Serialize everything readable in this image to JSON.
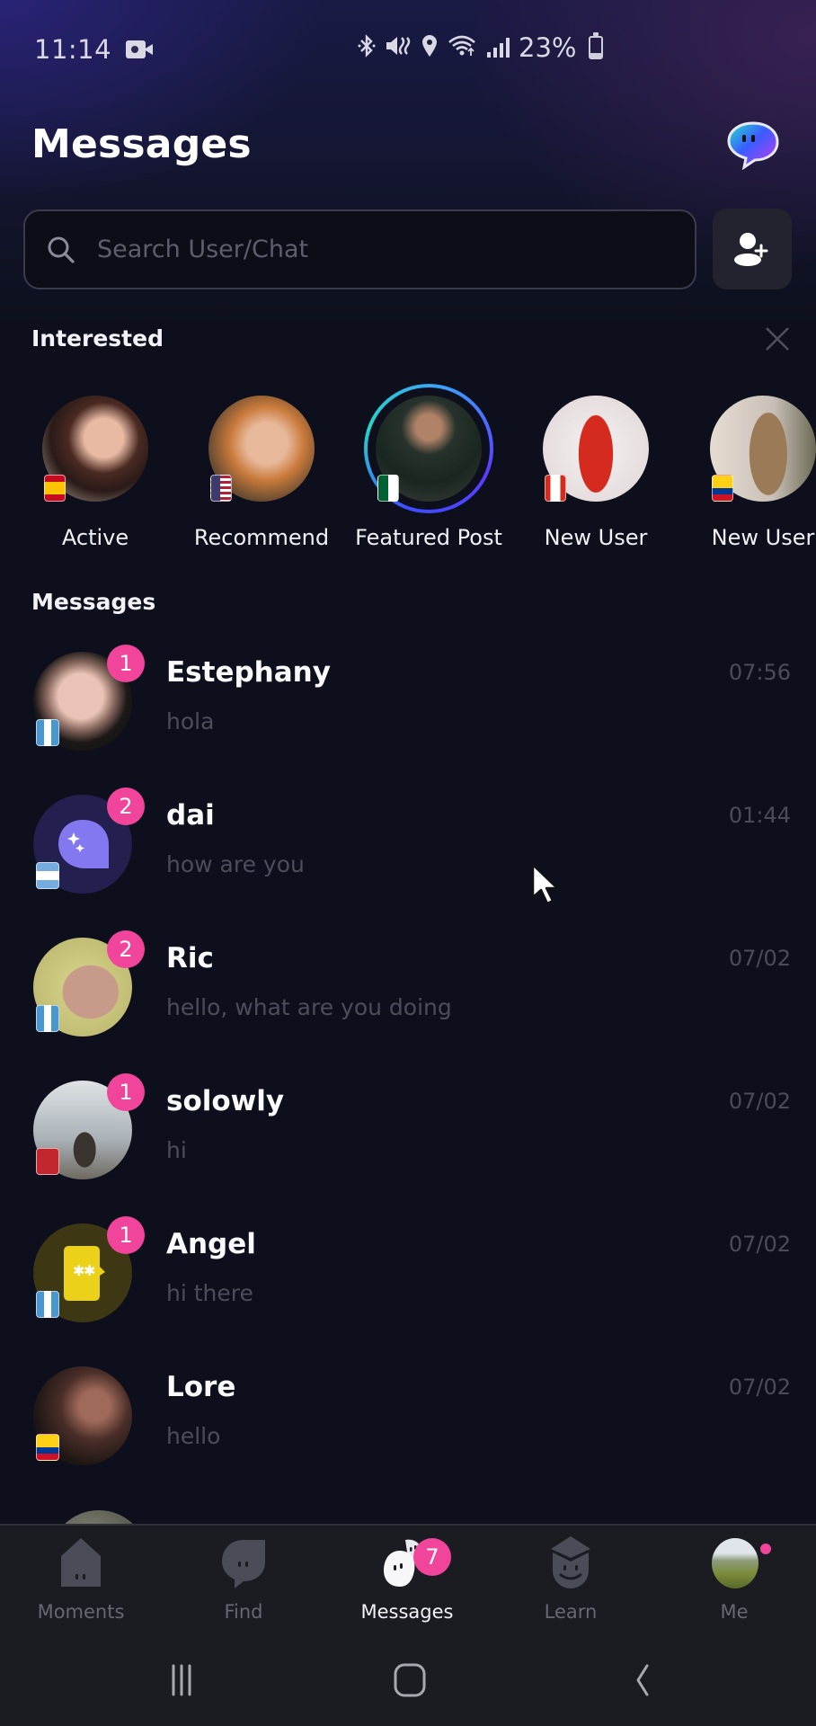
{
  "status_bar": {
    "time": "11:14",
    "battery_percent": "23%",
    "battery_level": 0.23,
    "icons": [
      "screen-record-icon",
      "bluetooth-icon",
      "mute-icon",
      "location-icon",
      "wifi-icon",
      "signal-icon",
      "battery-icon"
    ]
  },
  "header": {
    "title": "Messages",
    "bot_icon": "chat-bot-icon"
  },
  "search": {
    "placeholder": "Search User/Chat",
    "value": "",
    "add_user_icon": "add-user-icon"
  },
  "interested": {
    "title": "Interested",
    "close_icon": "close-icon",
    "items": [
      {
        "label": "Active",
        "flag": "Spain",
        "featured": false
      },
      {
        "label": "Recommend",
        "flag": "United States",
        "featured": false
      },
      {
        "label": "Featured Post",
        "flag": "Algeria",
        "featured": true
      },
      {
        "label": "New User",
        "flag": "Canada",
        "featured": false
      },
      {
        "label": "New User",
        "flag": "Colombia",
        "featured": false
      }
    ]
  },
  "messages": {
    "title": "Messages",
    "items": [
      {
        "name": "Estephany",
        "preview": "hola",
        "time": "07:56",
        "unread": "1",
        "flag": "Guatemala"
      },
      {
        "name": "dai",
        "preview": "how are you",
        "time": "01:44",
        "unread": "2",
        "flag": "Argentina"
      },
      {
        "name": "Ric",
        "preview": "hello, what are you doing",
        "time": "07/02",
        "unread": "2",
        "flag": "Guatemala"
      },
      {
        "name": "solowly",
        "preview": "hi",
        "time": "07/02",
        "unread": "1",
        "flag": "Morocco"
      },
      {
        "name": "Angel",
        "preview": "hi there",
        "time": "07/02",
        "unread": "1",
        "flag": "Guatemala"
      },
      {
        "name": "Lore",
        "preview": "hello",
        "time": "07/02",
        "unread": "",
        "flag": "Colombia"
      }
    ]
  },
  "tab_bar": {
    "tabs": [
      {
        "label": "Moments",
        "icon": "moments-icon",
        "active": false
      },
      {
        "label": "Find",
        "icon": "find-icon",
        "active": false
      },
      {
        "label": "Messages",
        "icon": "messages-icon",
        "active": true,
        "badge": "7"
      },
      {
        "label": "Learn",
        "icon": "learn-icon",
        "active": false
      },
      {
        "label": "Me",
        "icon": "profile-avatar",
        "active": false,
        "dot": true
      }
    ]
  },
  "nav_bar": {
    "buttons": [
      "recent-apps-icon",
      "home-icon",
      "back-icon"
    ]
  },
  "colors": {
    "accent_badge": "#f0459b",
    "background": "#0d101c",
    "muted_text": "#4b4d5c",
    "tab_bar": "#1b1c22"
  }
}
